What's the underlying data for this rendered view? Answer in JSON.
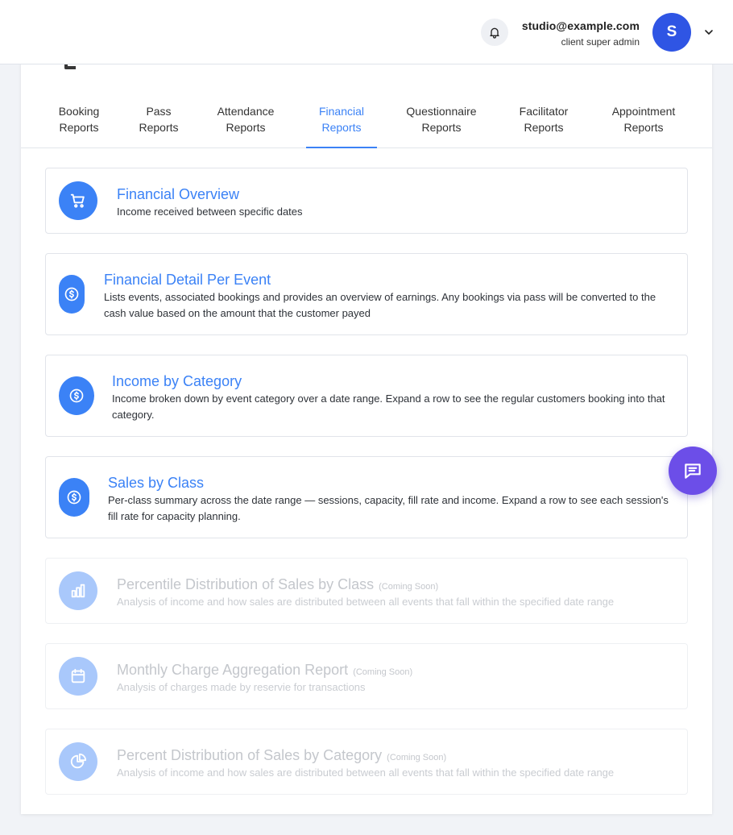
{
  "header": {
    "user_email": "studio@example.com",
    "user_role": "client super admin",
    "avatar_initial": "S"
  },
  "tabs": [
    {
      "line1": "Booking",
      "line2": "Reports"
    },
    {
      "line1": "Pass",
      "line2": "Reports"
    },
    {
      "line1": "Attendance",
      "line2": "Reports"
    },
    {
      "line1": "Financial",
      "line2": "Reports"
    },
    {
      "line1": "Questionnaire",
      "line2": "Reports"
    },
    {
      "line1": "Facilitator",
      "line2": "Reports"
    },
    {
      "line1": "Appointment",
      "line2": "Reports"
    }
  ],
  "active_tab": "Financial Reports",
  "reports": [
    {
      "title": "Financial Overview",
      "desc": "Income received between specific dates",
      "icon": "cart-icon",
      "coming_soon": ""
    },
    {
      "title": "Financial Detail Per Event",
      "desc": "Lists events, associated bookings and provides an overview of earnings. Any bookings via pass will be converted to the cash value based on the amount that the customer payed",
      "icon": "dollar-icon",
      "coming_soon": ""
    },
    {
      "title": "Income by Category",
      "desc": "Income broken down by event category over a date range. Expand a row to see the regular customers booking into that category.",
      "icon": "dollar-icon",
      "coming_soon": ""
    },
    {
      "title": "Sales by Class",
      "desc": "Per-class summary across the date range — sessions, capacity, fill rate and income. Expand a row to see each session's fill rate for capacity planning.",
      "icon": "dollar-icon",
      "coming_soon": ""
    },
    {
      "title": "Percentile Distribution of Sales by Class",
      "desc": "Analysis of income and how sales are distributed between all events that fall within the specified date range",
      "icon": "bar-chart-icon",
      "coming_soon": "(Coming Soon)"
    },
    {
      "title": "Monthly Charge Aggregation Report",
      "desc": "Analysis of charges made by reservie for transactions",
      "icon": "calendar-icon",
      "coming_soon": "(Coming Soon)"
    },
    {
      "title": "Percent Distribution of Sales by Category",
      "desc": "Analysis of income and how sales are distributed between all events that fall within the specified date range",
      "icon": "pie-chart-icon",
      "coming_soon": "(Coming Soon)"
    }
  ],
  "colors": {
    "accent": "#3b82f6",
    "avatar": "#2f55e4",
    "chat": "#6c4ee8",
    "disabled_icon": "#a9c8fb"
  }
}
